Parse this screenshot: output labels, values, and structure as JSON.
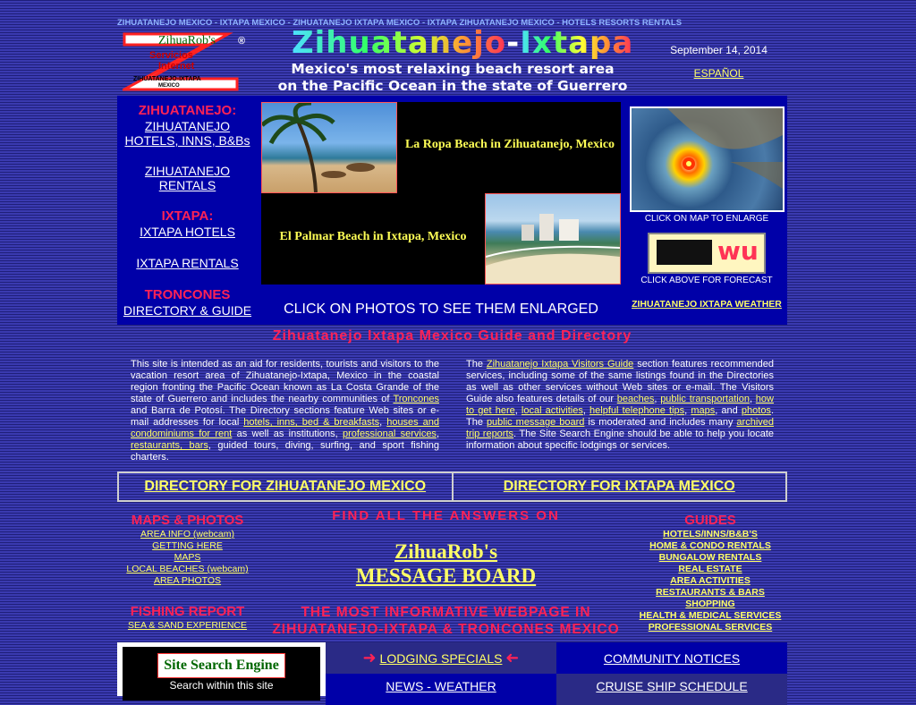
{
  "breadcrumb": "ZIHUATANEJO MEXICO - IXTAPA MEXICO - ZIHUATANEJO IXTAPA MEXICO - IXTAPA ZIHUATANEJO MEXICO - HOTELS RESORTS RENTALS",
  "logo": {
    "line1": "ZihuaRob's",
    "line2": "Servicios",
    "line3": "Internet",
    "line4": "ZIHUATANEJO-IXTAPA",
    "line5": "MEXICO",
    "reg": "®"
  },
  "header": {
    "title_part1": "Zihuatanejo",
    "title_dash": "-",
    "title_part2": "Ixtapa",
    "tagline_line1": "Mexico's most relaxing beach resort area",
    "tagline_line2": "on the Pacific Ocean in the state of Guerrero",
    "date": "September 14, 2014",
    "espanol": "ESPAÑOL"
  },
  "left_nav": {
    "zihua_head": "ZIHUATANEJO:",
    "zihua_hotels": "ZIHUATANEJO HOTELS, INNS, B&Bs",
    "zihua_rentals": "ZIHUATANEJO RENTALS",
    "ixtapa_head": "IXTAPA:",
    "ixtapa_hotels": "IXTAPA HOTELS",
    "ixtapa_rentals": "IXTAPA RENTALS",
    "troncones_head": "TRONCONES",
    "troncones_link": "DIRECTORY & GUIDE"
  },
  "photos": {
    "caption1": "La Ropa Beach in Zihuatanejo, Mexico",
    "caption2": "El Palmar Beach in Ixtapa, Mexico",
    "note": "CLICK ON PHOTOS TO SEE THEM ENLARGED"
  },
  "weather": {
    "map_note": "CLICK ON MAP TO ENLARGE",
    "wu_text": "wu",
    "forecast_note": "CLICK ABOVE FOR FORECAST",
    "weather_link": "ZIHUATANEJO IXTAPA WEATHER"
  },
  "guide_title": "Zihuatanejo Ixtapa Mexico Guide and Directory",
  "para_left": {
    "t1": "This site is intended as an aid for residents, tourists and visitors to the vacation resort area of Zihuatanejo-Ixtapa, Mexico in the coastal region fronting the Pacific Ocean known as La Costa Grande of the state of Guerrero and includes the nearby communities of ",
    "l1": "Troncones",
    "t2": " and Barra de Potosí. The Directory sections feature Web sites or e-mail addresses for local ",
    "l2": "hotels, inns, bed & breakfasts",
    "t3": ", ",
    "l3": "houses and condominiums for rent",
    "t4": " as well as institutions, ",
    "l4": "professional services",
    "t5": ", ",
    "l5": "restaurants, bars",
    "t6": ", guided tours, diving, surfing, and sport fishing charters."
  },
  "para_right": {
    "t1": "The ",
    "l1": "Zihuatanejo Ixtapa Visitors Guide",
    "t2": " section features recommended services, including some of the same listings found in the Directories as well as other services without Web sites or e-mail. The Visitors Guide also features details of our ",
    "l2": "beaches",
    "t3": ", ",
    "l3": "public transportation",
    "t4": ", ",
    "l4": "how to get here",
    "t5": ", ",
    "l5": "local activities",
    "t6": ", ",
    "l6": "helpful telephone tips",
    "t7": ", ",
    "l7": "maps",
    "t8": ", and ",
    "l8": "photos",
    "t9": ". The ",
    "l9": "public message board",
    "t10": " is moderated and includes many ",
    "l10": "archived trip reports",
    "t11": ". The Site Search Engine should be able to help you locate information about specific lodgings or services."
  },
  "directories": {
    "zihua": "DIRECTORY FOR ZIHUATANEJO MEXICO",
    "ixtapa": "DIRECTORY FOR IXTAPA MEXICO"
  },
  "maps_col": {
    "head": "MAPS & PHOTOS",
    "items": [
      "AREA INFO (webcam)",
      "GETTING HERE",
      "MAPS",
      "LOCAL BEACHES (webcam)",
      "AREA PHOTOS"
    ],
    "fishing_head": "FISHING REPORT",
    "fishing_link": "SEA & SAND EXPERIENCE"
  },
  "center_col": {
    "answers": "FIND ALL THE ANSWERS ON",
    "board_line1": "ZihuaRob's",
    "board_line2": "MESSAGE BOARD",
    "informative_line1": "THE MOST INFORMATIVE WEBPAGE IN",
    "informative_line2": "ZIHUATANEJO-IXTAPA & TRONCONES MEXICO"
  },
  "guides_col": {
    "head": "GUIDES",
    "items": [
      "HOTELS/INNS/B&B'S",
      "HOME & CONDO RENTALS",
      "BUNGALOW RENTALS",
      "REAL ESTATE",
      "AREA ACTIVITIES",
      "RESTAURANTS & BARS",
      "SHOPPING",
      "HEALTH & MEDICAL SERVICES",
      "PROFESSIONAL SERVICES"
    ]
  },
  "bottom": {
    "search_title": "Site Search Engine",
    "search_sub": "Search within this site",
    "lodging": "LODGING SPECIALS",
    "community": "COMMUNITY NOTICES",
    "news": "NEWS - WEATHER",
    "cruise": "CRUISE SHIP SCHEDULE"
  },
  "colors": {
    "background": "#2a2a86",
    "band": "#0000a8",
    "link": "#ffff66",
    "heading_red": "#ff2255",
    "search_green": "#006600"
  }
}
